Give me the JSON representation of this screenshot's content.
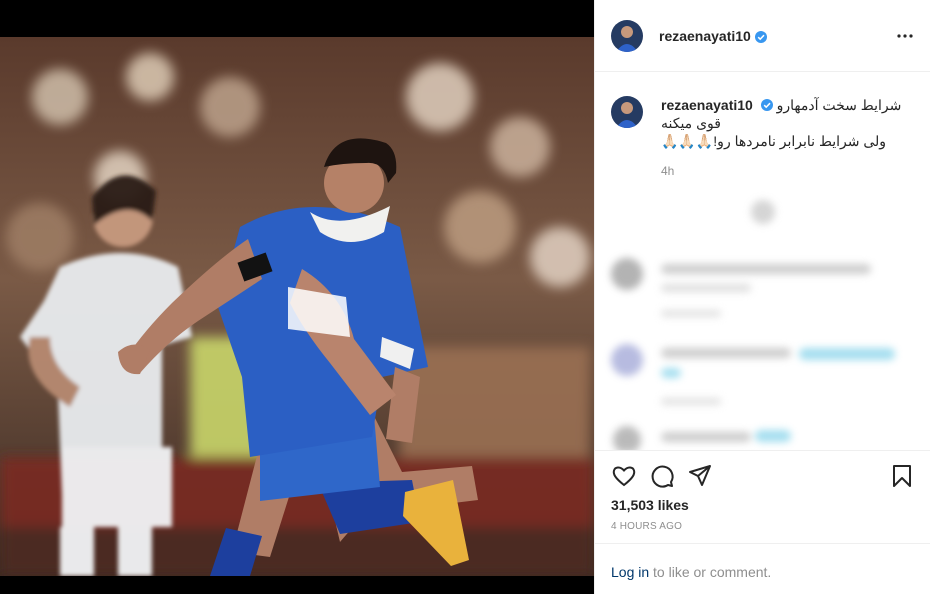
{
  "post": {
    "username": "rezaenayati10",
    "caption_lines": [
      "شرایط سخت آدمهارو",
      "قوی میکنه",
      "ولی شرایط نابرابر نامردها رو!🙏🏻🙏🏻🙏🏻"
    ],
    "caption_time": "4h",
    "likes": "31,503 likes",
    "posted_ago": "4 HOURS AGO",
    "login_link": "Log in",
    "login_rest": " to like or comment."
  },
  "icons": {
    "verified": "verified-badge-icon",
    "more": "more-options-icon",
    "like": "heart-icon",
    "comment": "comment-icon",
    "share": "share-icon",
    "save": "bookmark-icon"
  },
  "colors": {
    "verified": "#3897f0",
    "link": "#00376b",
    "muted": "#8e8e8e",
    "jersey": "#1f4fb4"
  }
}
